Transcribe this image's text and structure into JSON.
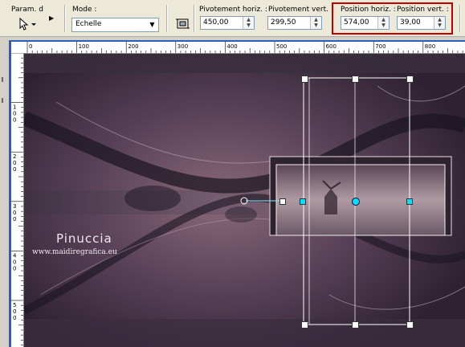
{
  "toolbar": {
    "presets_label": "Param. d",
    "mode_label": "Mode :",
    "mode_value": "Echelle",
    "pivot_h_label": "Pivotement horiz. :",
    "pivot_h_value": "450,00",
    "pivot_v_label": "Pivotement vert. :",
    "pivot_v_value": "299,50",
    "pos_h_label": "Position horiz. :",
    "pos_h_value": "574,00",
    "pos_v_label": "Position vert. :",
    "pos_v_value": "39,00"
  },
  "ruler_top": [
    "0",
    "100",
    "200",
    "300",
    "400",
    "500",
    "600",
    "700",
    "800"
  ],
  "ruler_left": [
    {
      "label": "1\n0\n0"
    },
    {
      "label": "2\n0\n0"
    },
    {
      "label": "3\n0\n0"
    },
    {
      "label": "4\n0\n0"
    },
    {
      "label": "5\n0\n0"
    }
  ],
  "canvas": {
    "watermark_name": "Pinuccia",
    "watermark_url": "www.maidiregrafica.eu"
  },
  "colors": {
    "highlight": "#c00000",
    "frame": "#2a5fc0",
    "handle": "#00e0ff"
  }
}
